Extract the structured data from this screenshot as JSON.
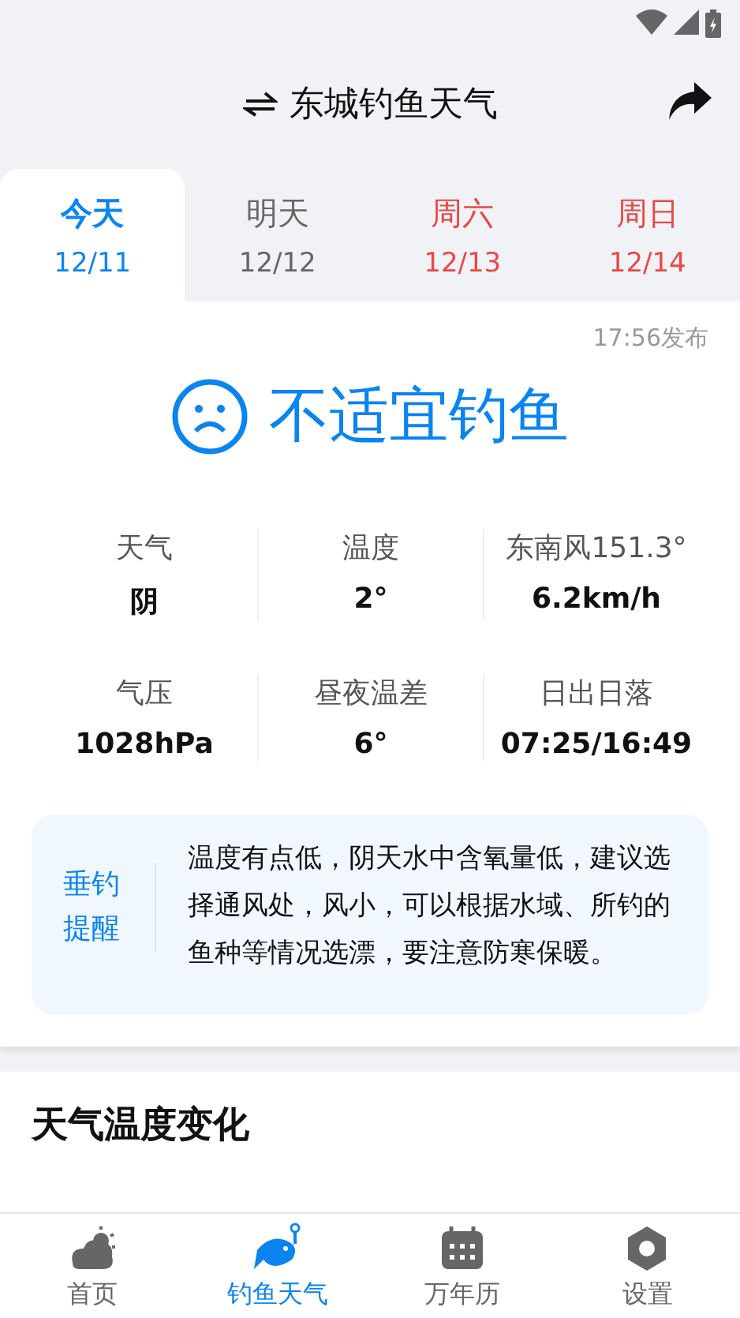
{
  "header": {
    "title": "东城钓鱼天气"
  },
  "tabs": [
    {
      "label": "今天",
      "date": "12/11",
      "kind": "weekday",
      "selected": true
    },
    {
      "label": "明天",
      "date": "12/12",
      "kind": "weekday",
      "selected": false
    },
    {
      "label": "周六",
      "date": "12/13",
      "kind": "weekend",
      "selected": false
    },
    {
      "label": "周日",
      "date": "12/14",
      "kind": "weekend",
      "selected": false
    }
  ],
  "published": "17:56发布",
  "verdict": {
    "text": "不适宜钓鱼"
  },
  "stats": [
    {
      "label": "天气",
      "value": "阴"
    },
    {
      "label": "温度",
      "value": "2°"
    },
    {
      "label": "东南风151.3°",
      "value": "6.2km/h"
    },
    {
      "label": "气压",
      "value": "1028hPa"
    },
    {
      "label": "昼夜温差",
      "value": "6°"
    },
    {
      "label": "日出日落",
      "value": "07:25/16:49"
    }
  ],
  "tip": {
    "title": "垂钓提醒",
    "text": "温度有点低，阴天水中含氧量低，建议选择通风处，风小，可以根据水域、所钓的鱼种等情况选漂，要注意防寒保暖。"
  },
  "section_title": "天气温度变化",
  "nav": [
    {
      "label": "首页",
      "selected": false
    },
    {
      "label": "钓鱼天气",
      "selected": true
    },
    {
      "label": "万年历",
      "selected": false
    },
    {
      "label": "设置",
      "selected": false
    }
  ]
}
